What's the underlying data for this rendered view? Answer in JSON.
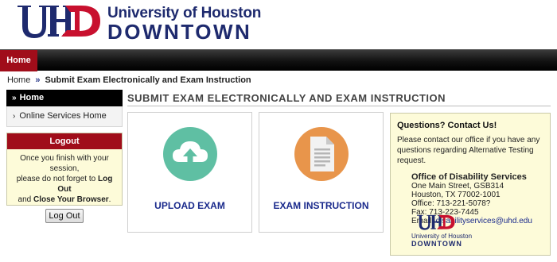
{
  "header": {
    "logo_letters": "UHD",
    "university": "University of Houston",
    "campus": "DOWNTOWN"
  },
  "nav": {
    "home": "Home"
  },
  "breadcrumb": {
    "home": "Home",
    "separator": "»",
    "current": "Submit Exam Electronically and Exam Instruction"
  },
  "sidebar": {
    "header": "Home",
    "items": [
      {
        "label": "Online Services Home"
      }
    ]
  },
  "logout": {
    "title": "Logout",
    "line1": "Once you finish with your session,",
    "line2_prefix": "please do not forget to ",
    "line2_bold": "Log Out",
    "line3_prefix": "and ",
    "line3_bold": "Close Your Browser",
    "line3_suffix": ".",
    "button": "Log Out"
  },
  "main": {
    "title": "SUBMIT EXAM ELECTRONICALLY AND EXAM INSTRUCTION",
    "cards": [
      {
        "label": "UPLOAD EXAM",
        "icon": "cloud-upload-icon",
        "color": "#5fbfa3"
      },
      {
        "label": "EXAM INSTRUCTION",
        "icon": "document-icon",
        "color": "#e8954b"
      }
    ]
  },
  "contact": {
    "title": "Questions? Contact Us!",
    "text": "Please contact our office if you have any questions regarding Alternative Testing request.",
    "office": "Office of Disability Services",
    "street": "One Main Street, GSB314",
    "city": "Houston, TX 77002-1001",
    "phone": "Office: 713-221-5078?",
    "fax": "Fax: 713-223-7445",
    "email_label": "Email: ",
    "email": "disabilityservices@uhd.edu",
    "logo_university": "University of Houston",
    "logo_campus": "DOWNTOWN"
  },
  "colors": {
    "brand_red": "#a00d1a",
    "brand_blue": "#1e2a6e",
    "panel_yellow": "#fdfbd9"
  }
}
